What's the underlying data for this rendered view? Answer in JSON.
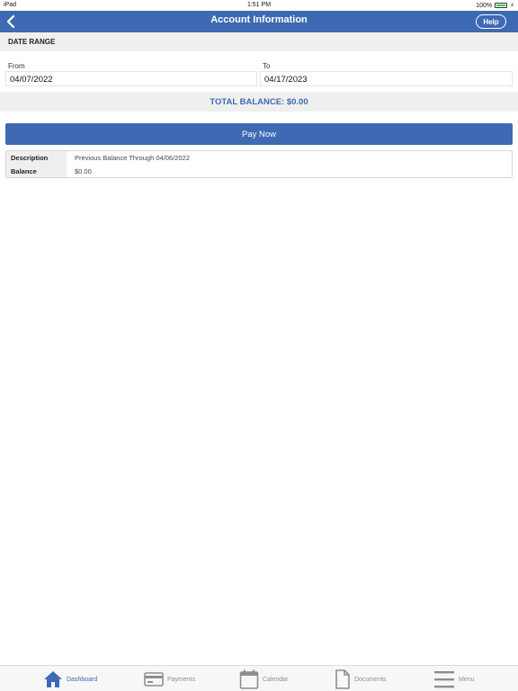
{
  "status_bar": {
    "device": "iPad",
    "time": "1:51 PM",
    "battery": "100%"
  },
  "header": {
    "title": "Account Information",
    "help_label": "Help"
  },
  "date_range": {
    "section_label": "DATE RANGE",
    "from_label": "From",
    "from_value": "04/07/2022",
    "to_label": "To",
    "to_value": "04/17/2023"
  },
  "total_balance": "TOTAL BALANCE: $0.00",
  "pay_now_label": "Pay Now",
  "details": [
    {
      "key": "Description",
      "value": "Previous Balance Through 04/06/2022"
    },
    {
      "key": "Balance",
      "value": "$0.00"
    }
  ],
  "tabs": [
    {
      "label": "Dashboard",
      "icon": "home-icon",
      "active": true
    },
    {
      "label": "Payments",
      "icon": "credit-card-icon",
      "active": false
    },
    {
      "label": "Calendar",
      "icon": "calendar-icon",
      "active": false
    },
    {
      "label": "Documents",
      "icon": "document-icon",
      "active": false
    },
    {
      "label": "Menu",
      "icon": "menu-icon",
      "active": false
    }
  ],
  "colors": {
    "primary": "#3d6ab3",
    "section_bg": "#efefef",
    "battery": "#34c759"
  }
}
